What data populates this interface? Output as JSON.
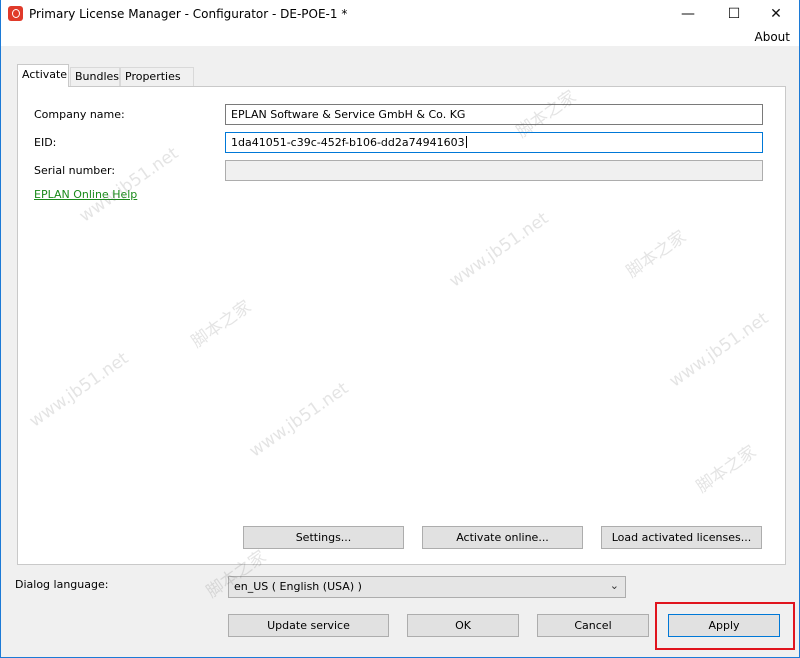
{
  "window": {
    "title": "Primary License Manager - Configurator - DE-POE-1 *",
    "minimize": "—",
    "maximize": "☐",
    "close": "✕"
  },
  "menu": {
    "about": "About"
  },
  "tabs": [
    {
      "label": "Activate",
      "active": true
    },
    {
      "label": "Bundles",
      "active": false
    },
    {
      "label": "Properties",
      "active": false
    }
  ],
  "form": {
    "company_label": "Company name:",
    "company_value": "EPLAN Software & Service GmbH & Co. KG",
    "eid_label": "EID:",
    "eid_value": "1da41051-c39c-452f-b106-dd2a74941603",
    "serial_label": "Serial number:",
    "serial_value": "",
    "help_link": "EPLAN Online Help"
  },
  "panel_buttons": {
    "settings": "Settings...",
    "activate_online": "Activate online...",
    "load_licenses": "Load activated licenses..."
  },
  "language": {
    "label": "Dialog language:",
    "selected": "en_US ( English (USA) )"
  },
  "footer_buttons": {
    "update_service": "Update service",
    "ok": "OK",
    "cancel": "Cancel",
    "apply": "Apply"
  },
  "watermark": {
    "site": "www.jb51.net",
    "brand": "脚本之家"
  },
  "colors": {
    "accent": "#0078d7",
    "link": "#1a8a1a",
    "highlight": "#e0141e"
  }
}
